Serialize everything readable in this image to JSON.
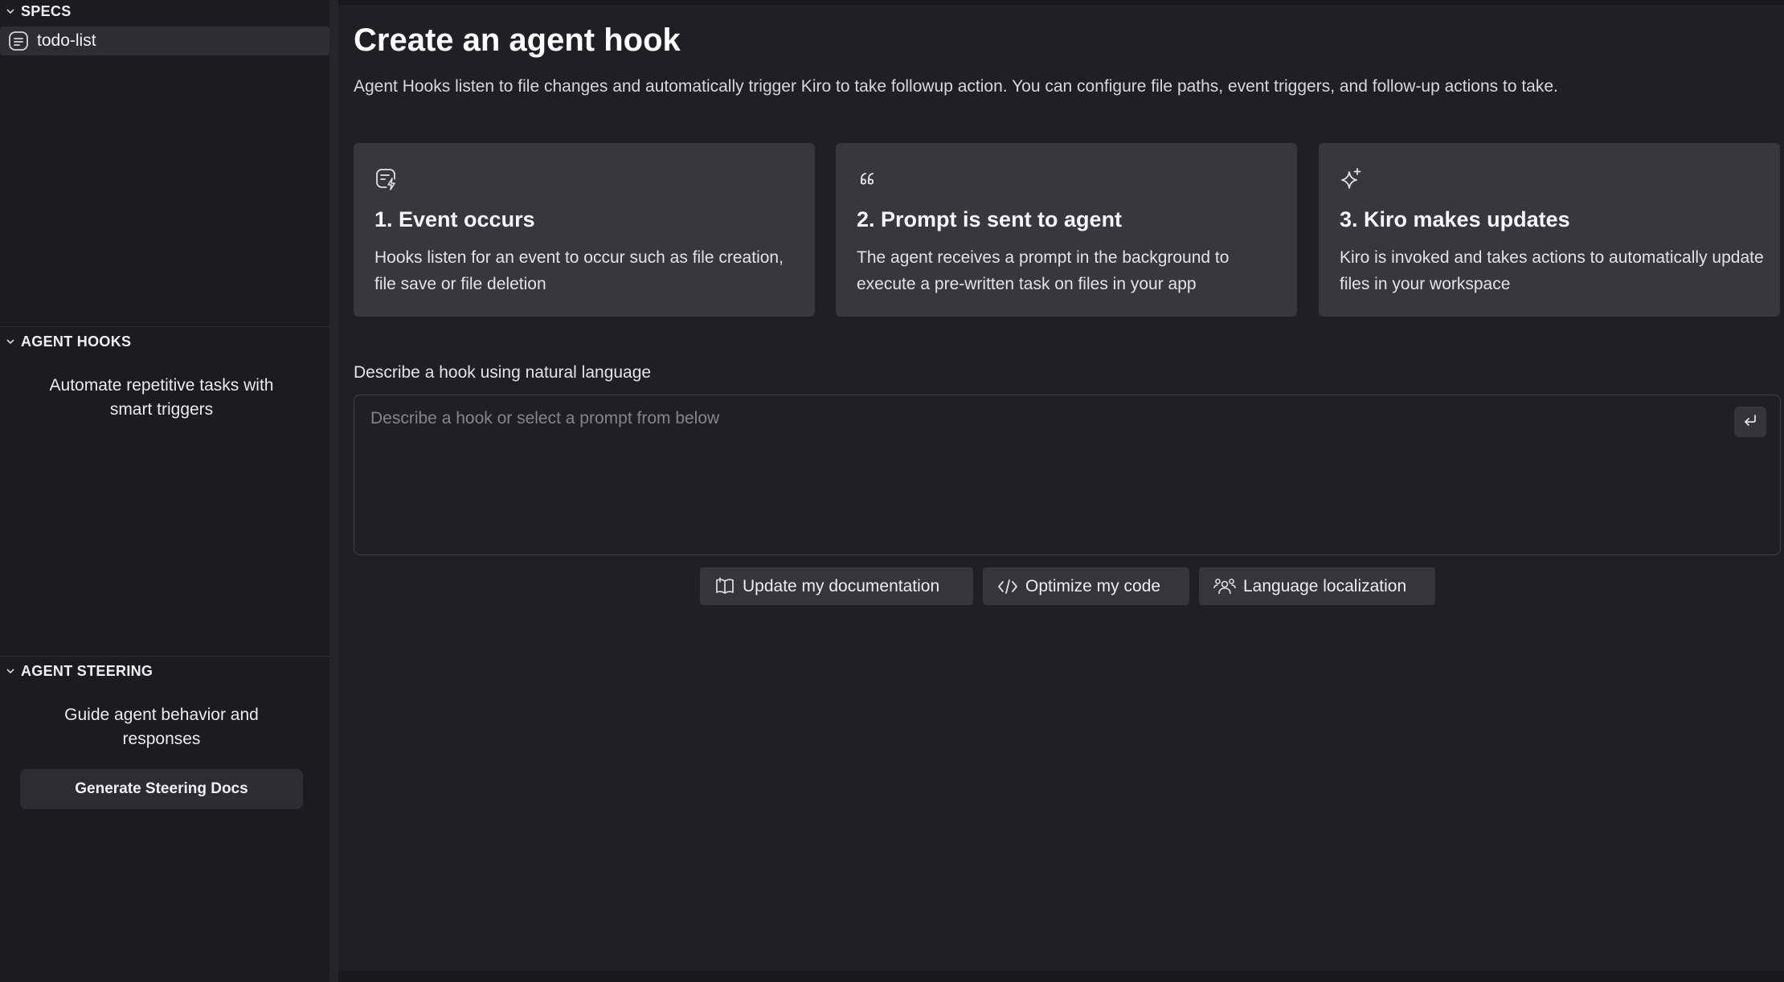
{
  "sidebar": {
    "specs": {
      "header": "SPECS",
      "items": [
        {
          "label": "todo-list",
          "icon": "document-lines-icon"
        }
      ]
    },
    "agent_hooks": {
      "header": "AGENT HOOKS",
      "empty_message": "Automate repetitive tasks with smart triggers"
    },
    "agent_steering": {
      "header": "AGENT STEERING",
      "empty_message": "Guide agent behavior and responses",
      "button_label": "Generate Steering Docs"
    }
  },
  "main": {
    "title": "Create an agent hook",
    "description": "Agent Hooks listen to file changes and automatically trigger Kiro to take followup action. You can configure file paths, event triggers, and follow-up actions to take.",
    "cards": [
      {
        "icon": "event-trigger-icon",
        "title": "1. Event occurs",
        "body": "Hooks listen for an event to occur such as file creation, file save or file deletion"
      },
      {
        "icon": "quote-icon",
        "title": "2. Prompt is sent to agent",
        "body": "The agent receives a prompt in the background to execute a pre-written task on files in your app"
      },
      {
        "icon": "sparkle-icon",
        "title": "3. Kiro makes updates",
        "body": "Kiro is invoked and takes actions to automatically update files in your workspace"
      }
    ],
    "input": {
      "label": "Describe a hook using natural language",
      "placeholder": "Describe a hook or select a prompt from below",
      "value": ""
    },
    "suggestions": [
      {
        "icon": "book-icon",
        "label": "Update my documentation"
      },
      {
        "icon": "code-icon",
        "label": "Optimize my code"
      },
      {
        "icon": "users-icon",
        "label": "Language localization"
      }
    ]
  },
  "colors": {
    "background": "#211f26",
    "sidebar": "#1c1b20",
    "card": "#38363e",
    "chip": "#36343c"
  }
}
